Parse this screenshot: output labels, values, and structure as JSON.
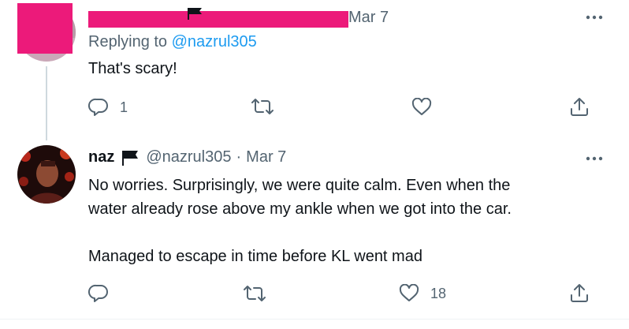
{
  "tweet1": {
    "date": "Mar 7",
    "replying_prefix": "Replying to",
    "replying_handle": "@nazrul305",
    "text": "That's scary!",
    "reply_count": "1"
  },
  "tweet2": {
    "name": "naz",
    "handle": "@nazrul305",
    "separator": "·",
    "date": "Mar 7",
    "text_lines": [
      "No worries. Surprisingly, we were quite calm. Even when the",
      "water already rose above my ankle when we got into the car.",
      "",
      "Managed to escape in time before KL went mad"
    ],
    "like_count": "18"
  },
  "icons": {
    "more": "more-horizontal-icon",
    "reply": "reply-icon",
    "retweet": "retweet-icon",
    "like": "heart-icon",
    "share": "share-icon",
    "flag": "black-flag-icon"
  },
  "colors": {
    "redaction": "#ec1a7a",
    "link": "#1d9bf0",
    "muted": "#536471",
    "text": "#0f1419",
    "thread_line": "#cfd9de"
  }
}
